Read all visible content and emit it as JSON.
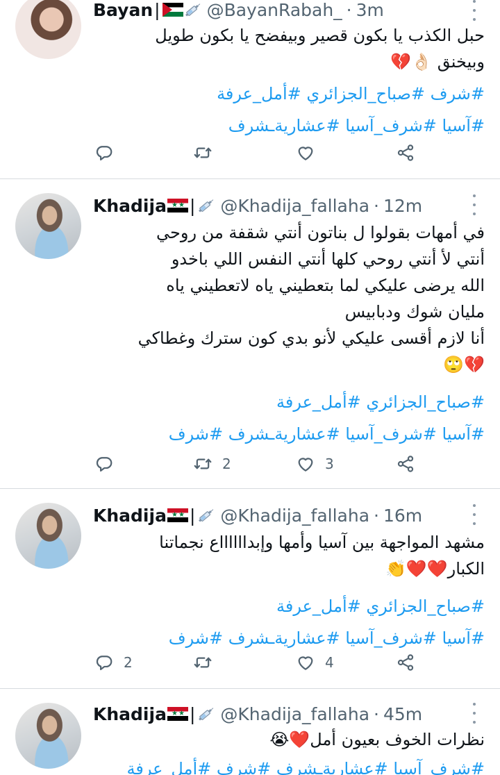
{
  "tweets": [
    {
      "name": "Bayan",
      "handle": "@BayanRabah_",
      "dot": "·",
      "time": "3m",
      "text_lines": [
        "حبل الكذب يا بكون قصير وبيفضح يا بكون طويل",
        "وبيخنق 👌🏻💔"
      ],
      "hashtag_lines": [
        "#شرف #صباح_الجزائري #أمل_عرفة",
        "#آسيا #شرف_آسيا #عشاريةـشرف"
      ],
      "reply_count": "",
      "retweet_count": "",
      "like_count": ""
    },
    {
      "name": "Khadija",
      "handle": "@Khadija_fallaha",
      "dot": "·",
      "time": "12m",
      "text_lines": [
        "في أمهات بقولوا ل بناتون أنتي شقفة من روحي",
        "أنتي لأ أنتي روحي كلها أنتي النفس اللي باخدو",
        "الله يرضى عليكي لما بتعطيني ياه لاتعطيني ياه",
        "مليان شوك ودبابيس",
        "أنا لازم أقسى عليكي لأنو بدي كون سترك وغطاكي",
        "💔🙄"
      ],
      "hashtag_lines": [
        "#صباح_الجزائري #أمل_عرفة",
        "#آسيا #شرف_آسيا #عشاريةـشرف #شرف"
      ],
      "reply_count": "",
      "retweet_count": "2",
      "like_count": "3"
    },
    {
      "name": "Khadija",
      "handle": "@Khadija_fallaha",
      "dot": "·",
      "time": "16m",
      "text_lines": [
        "مشهد المواجهة بين آسيا وأمها وإبدااااااع نجماتنا",
        "الكبار❤️❤️👏"
      ],
      "hashtag_lines": [
        "#صباح_الجزائري #أمل_عرفة",
        "#آسيا #شرف_آسيا #عشاريةـشرف #شرف"
      ],
      "reply_count": "2",
      "retweet_count": "",
      "like_count": "4"
    },
    {
      "name": "Khadija",
      "handle": "@Khadija_fallaha",
      "dot": "·",
      "time": "45m",
      "text_lines": [
        "نظرات الخوف بعيون أمل❤️😭"
      ],
      "hashtag_lines": [
        "#شرف_آسيا #عشاريةـشرف #شرف #أمل_عرفة"
      ],
      "reply_count": "",
      "retweet_count": "",
      "like_count": ""
    }
  ],
  "icons": {
    "reply": "reply-icon",
    "retweet": "retweet-icon",
    "like": "heart-icon",
    "share": "share-icon",
    "more": "more-options-icon",
    "verified_badge": "syringe-icon"
  }
}
